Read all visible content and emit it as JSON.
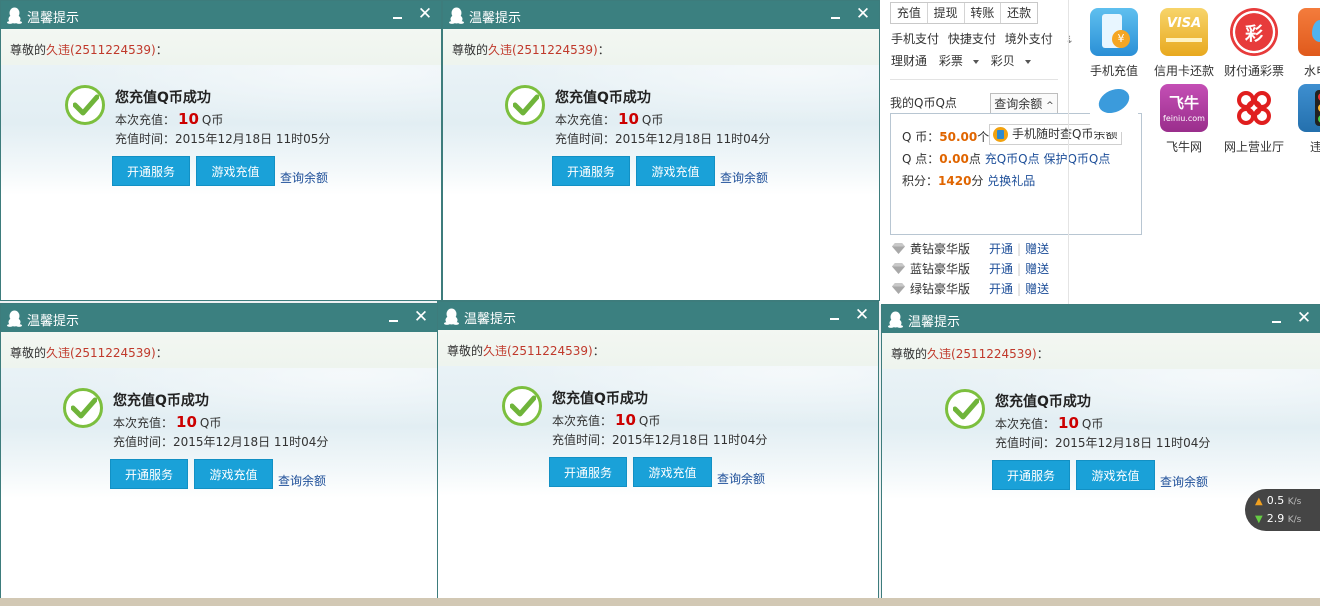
{
  "popup": {
    "title": "温馨提示",
    "greeting_prefix": "尊敬的",
    "user_name": "久违",
    "user_id": "(2511224539)",
    "greeting_suffix": "：",
    "headline": "您充值Q币成功",
    "amount_label": "本次充值：",
    "amount_value": "10",
    "amount_unit": "Q币",
    "btn_service": "开通服务",
    "btn_game": "游戏充值",
    "link_balance": "查询余额",
    "close_glyph": "✕"
  },
  "popups": [
    {
      "time": "充值时间：2015年12月18日 11时05分"
    },
    {
      "time": "充值时间：2015年12月18日 11时04分"
    },
    {
      "time": "充值时间：2015年12月18日 11时04分"
    },
    {
      "time": "充值时间：2015年12月18日 11时04分"
    },
    {
      "time": "充值时间：2015年12月18日 11时04分"
    }
  ],
  "tenpay": {
    "tabs": [
      "充值",
      "提现",
      "转账",
      "还款"
    ],
    "row2": [
      "手机支付",
      "快捷支付",
      "境外支付"
    ],
    "row3": [
      "理财通",
      "彩票",
      "彩贝"
    ],
    "my_q_label": "我的Q币Q点",
    "query_btn": "查询余额",
    "balance": {
      "q_coin_label": "Q 币：",
      "q_coin_value": "50.00",
      "q_coin_unit": "个",
      "tip": "手机随时查Q币余额",
      "q_point_label": "Q 点：",
      "q_point_value": "0.00",
      "q_point_unit": "点",
      "link_recharge": "充Q币Q点",
      "link_protect": "保护Q币Q点",
      "score_label": "积分：",
      "score_value": "1420",
      "score_unit": "分",
      "link_gift": "兑换礼品"
    },
    "vip": [
      {
        "name": "黄钻豪华版",
        "open": "开通",
        "gift": "赠送",
        "color": "#aaaaaa"
      },
      {
        "name": "蓝钻豪华版",
        "open": "开通",
        "gift": "赠送",
        "color": "#aaaaaa"
      },
      {
        "name": "绿钻豪华版",
        "open": "开通",
        "gift": "赠送",
        "color": "#aaaaaa"
      }
    ],
    "apps": [
      {
        "label": "手机充值"
      },
      {
        "label": "信用卡还款",
        "badge": "VISA"
      },
      {
        "label": "财付通彩票",
        "badge": "彩"
      },
      {
        "label": "水电煤"
      },
      {
        "label": "飞牛网",
        "badge": "飞牛",
        "sub": "feiniu.com"
      },
      {
        "label": "网上营业厅"
      },
      {
        "label": "违章"
      }
    ]
  },
  "speed": {
    "up": "0.5",
    "down": "2.9",
    "unit": "K/s"
  }
}
